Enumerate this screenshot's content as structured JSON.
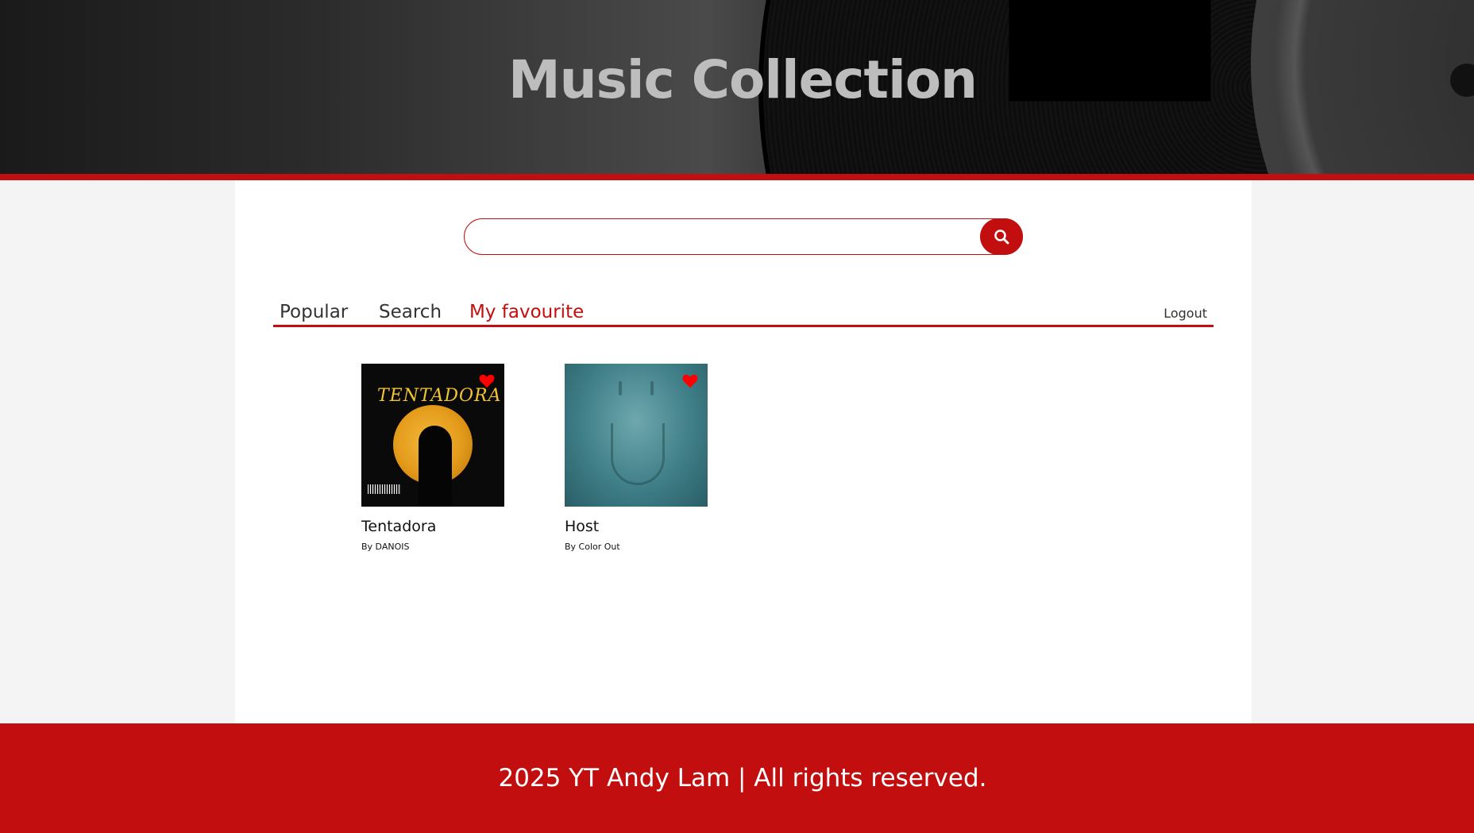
{
  "header": {
    "title": "Music Collection"
  },
  "search": {
    "value": "",
    "placeholder": "",
    "button_icon": "search-icon"
  },
  "tabs": [
    {
      "label": "Popular",
      "active": false
    },
    {
      "label": "Search",
      "active": false
    },
    {
      "label": "My favourite",
      "active": true
    }
  ],
  "logout_label": "Logout",
  "songs": [
    {
      "title": "Tentadora",
      "artist": "By DANOIS",
      "cover_text": "TENTADORA",
      "favourite": true
    },
    {
      "title": "Host",
      "artist": "By Color Out",
      "favourite": true
    }
  ],
  "footer": {
    "text": "2025 YT Andy Lam | All rights reserved."
  },
  "colors": {
    "accent": "#c20e0e",
    "heart": "#ff0000"
  }
}
